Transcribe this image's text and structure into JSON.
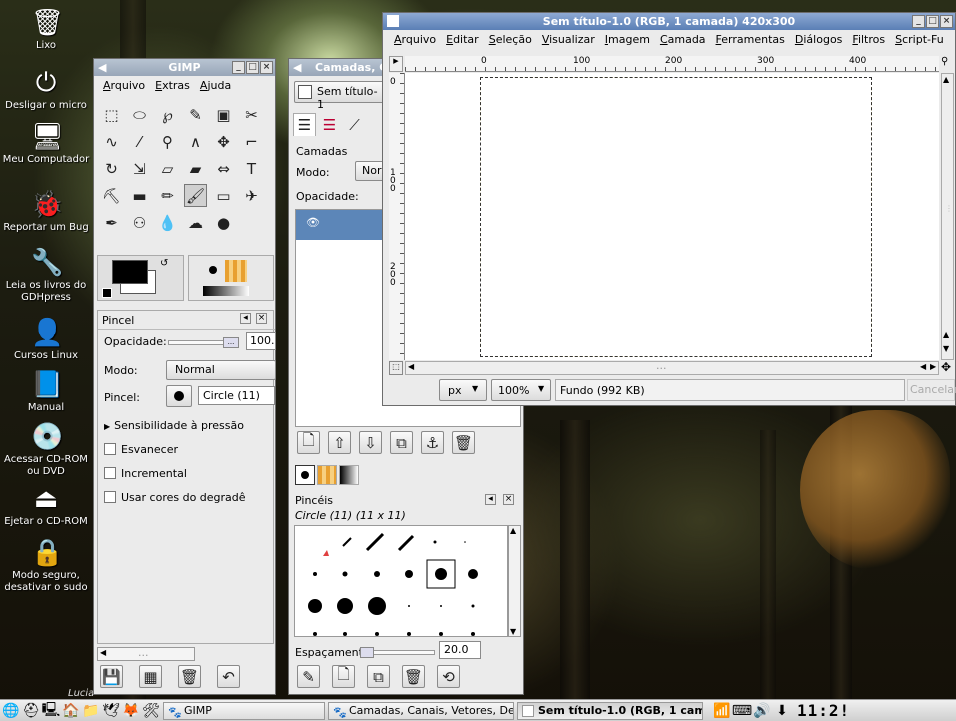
{
  "desktop": {
    "icons": [
      {
        "label": "Lixo",
        "icon": "trash-icon",
        "glyph": "🗑"
      },
      {
        "label": "Desligar o micro",
        "icon": "power-icon",
        "glyph": "⏻"
      },
      {
        "label": "Meu Computador",
        "icon": "computer-icon",
        "glyph": "🖥"
      },
      {
        "label": "Reportar um Bug",
        "icon": "bug-report-icon",
        "glyph": "🐞"
      },
      {
        "label": "Leia os livros do GDHpress",
        "icon": "tools-icon",
        "glyph": "🔧"
      },
      {
        "label": "Cursos Linux",
        "icon": "user-icon",
        "glyph": "👤"
      },
      {
        "label": "Manual",
        "icon": "book-icon",
        "glyph": "📘"
      },
      {
        "label": "Acessar CD-ROM ou DVD",
        "icon": "cdrom-icon",
        "glyph": "💿"
      },
      {
        "label": "Ejetar o CD-ROM",
        "icon": "eject-icon",
        "glyph": "⏏"
      },
      {
        "label": "Modo seguro, desativar o sudo",
        "icon": "lock-icon",
        "glyph": "🔒"
      }
    ],
    "watermark": "Lucia"
  },
  "toolbox": {
    "title": "GIMP",
    "menu": [
      "Arquivo",
      "Extras",
      "Ajuda"
    ],
    "tools": [
      "rect-select-icon",
      "ellipse-select-icon",
      "lasso-icon",
      "fuzzy-select-icon",
      "color-select-icon",
      "scissors-icon",
      "paths-icon",
      "color-picker-icon",
      "zoom-icon",
      "measure-icon",
      "move-icon",
      "crop-icon",
      "rotate-icon",
      "scale-icon",
      "shear-icon",
      "perspective-icon",
      "flip-icon",
      "text-icon",
      "bucket-fill-icon",
      "blend-icon",
      "pencil-icon",
      "paintbrush-icon",
      "eraser-icon",
      "airbrush-icon",
      "ink-icon",
      "clone-icon",
      "convolve-icon",
      "smudge-icon",
      "dodge-icon"
    ],
    "tool_glyphs": [
      "⬚",
      "⬭",
      "℘",
      "✎",
      "▣",
      "✂",
      "∿",
      "⁄",
      "⚲",
      "∧",
      "✥",
      "⌐",
      "↻",
      "⇲",
      "▱",
      "▰",
      "⇔",
      "T",
      "⛏",
      "▬",
      "✏",
      "🖌",
      "▭",
      "✈",
      "✒",
      "⚇",
      "💧",
      "☁",
      "●"
    ],
    "active_tool_index": 21
  },
  "tool_options": {
    "title": "Pincel",
    "opacity_label": "Opacidade:",
    "opacity_value": "100.",
    "mode_label": "Modo:",
    "mode_value": "Normal",
    "brush_label": "Pincel:",
    "brush_value": "Circle (11)",
    "pressure_label": "Sensibilidade à pressão",
    "options": [
      "Esvanecer",
      "Incremental",
      "Usar cores do degradê"
    ],
    "bottom_scroll": "...",
    "buttons": [
      "save-icon",
      "restore-icon",
      "delete-icon",
      "reset-icon"
    ]
  },
  "layers": {
    "title": "Camadas, C",
    "image_label": "Sem título-1",
    "section_label": "Camadas",
    "mode_label": "Modo:",
    "mode_value": "Nor",
    "opacity_label": "Opacidade:",
    "buttons": [
      "new-layer-icon",
      "raise-icon",
      "lower-icon",
      "duplicate-icon",
      "anchor-icon",
      "delete-icon"
    ]
  },
  "brushes": {
    "title": "Pincéis",
    "current": "Circle (11) (11 x 11)",
    "spacing_label": "Espaçamento:",
    "spacing_value": "20.0",
    "buttons": [
      "edit-brush-icon",
      "new-brush-icon",
      "duplicate-brush-icon",
      "delete-brush-icon",
      "refresh-icon"
    ]
  },
  "image_window": {
    "title": "Sem título-1.0 (RGB, 1 camada) 420x300",
    "menu": [
      "Arquivo",
      "Editar",
      "Seleção",
      "Visualizar",
      "Imagem",
      "Camada",
      "Ferramentas",
      "Diálogos",
      "Filtros",
      "Script-Fu"
    ],
    "ruler_labels": [
      "0",
      "100",
      "200",
      "300",
      "400"
    ],
    "vruler_labels": [
      "0",
      "1 0 0",
      "2 0 0"
    ],
    "unit": "px",
    "zoom": "100%",
    "status": "Fundo (992 KB)",
    "cancel": "Cancelar",
    "scroll_dots": "..."
  },
  "taskbar": {
    "tasks": [
      {
        "label": "GIMP",
        "active": false
      },
      {
        "label": "Camadas, Canais, Vetores, De",
        "active": false
      },
      {
        "label": "Sem título-1.0 (RGB, 1 cam",
        "active": true
      }
    ],
    "clock": "11:2!"
  }
}
